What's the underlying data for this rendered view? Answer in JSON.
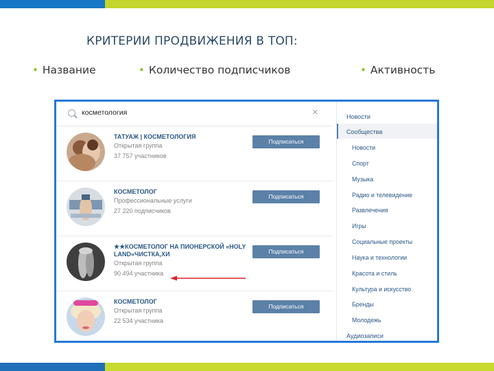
{
  "slide": {
    "title": "КРИТЕРИИ ПРОДВИЖЕНИЯ В ТОП:",
    "bullets": [
      "Название",
      "Количество подписчиков",
      "Активность"
    ]
  },
  "search": {
    "query": "косметология",
    "clear_icon": "×"
  },
  "results": [
    {
      "name": "ТАТУАЖ | КОСМЕТОЛОГИЯ",
      "type": "Открытая группа",
      "members": "37 757 участников",
      "button": "Подписаться"
    },
    {
      "name": "КОСМЕТОЛОГ",
      "type": "Профессиональные услуги",
      "members": "27 220 подписчиков",
      "button": "Подписаться"
    },
    {
      "name": "★★КОСМЕТОЛОГ НА ПИОНЕРСКОЙ «HOLY LAND»ЧИСТКА,ХИ",
      "type": "Открытая группа",
      "members": "90 494 участника",
      "button": "Подписаться"
    },
    {
      "name": "КОСМЕТОЛОГ",
      "type": "Открытая группа",
      "members": "22 534 участника",
      "button": "Подписаться"
    }
  ],
  "nav": {
    "top": [
      "Новости",
      "Сообщества"
    ],
    "categories": [
      "Новости",
      "Спорт",
      "Музыка",
      "Радио и телевидение",
      "Развлечения",
      "Игры",
      "Социальные проекты",
      "Наука и технологии",
      "Красота и стиль",
      "Культура и искусство",
      "Бренды",
      "Молодежь"
    ],
    "bottom": "Аудиозаписи"
  },
  "colors": {
    "accent_blue": "#1577c5",
    "accent_green": "#c3d52a",
    "frame_border": "#2778d8",
    "link": "#2a5885",
    "button": "#5b81a8",
    "arrow": "#d9262a"
  }
}
